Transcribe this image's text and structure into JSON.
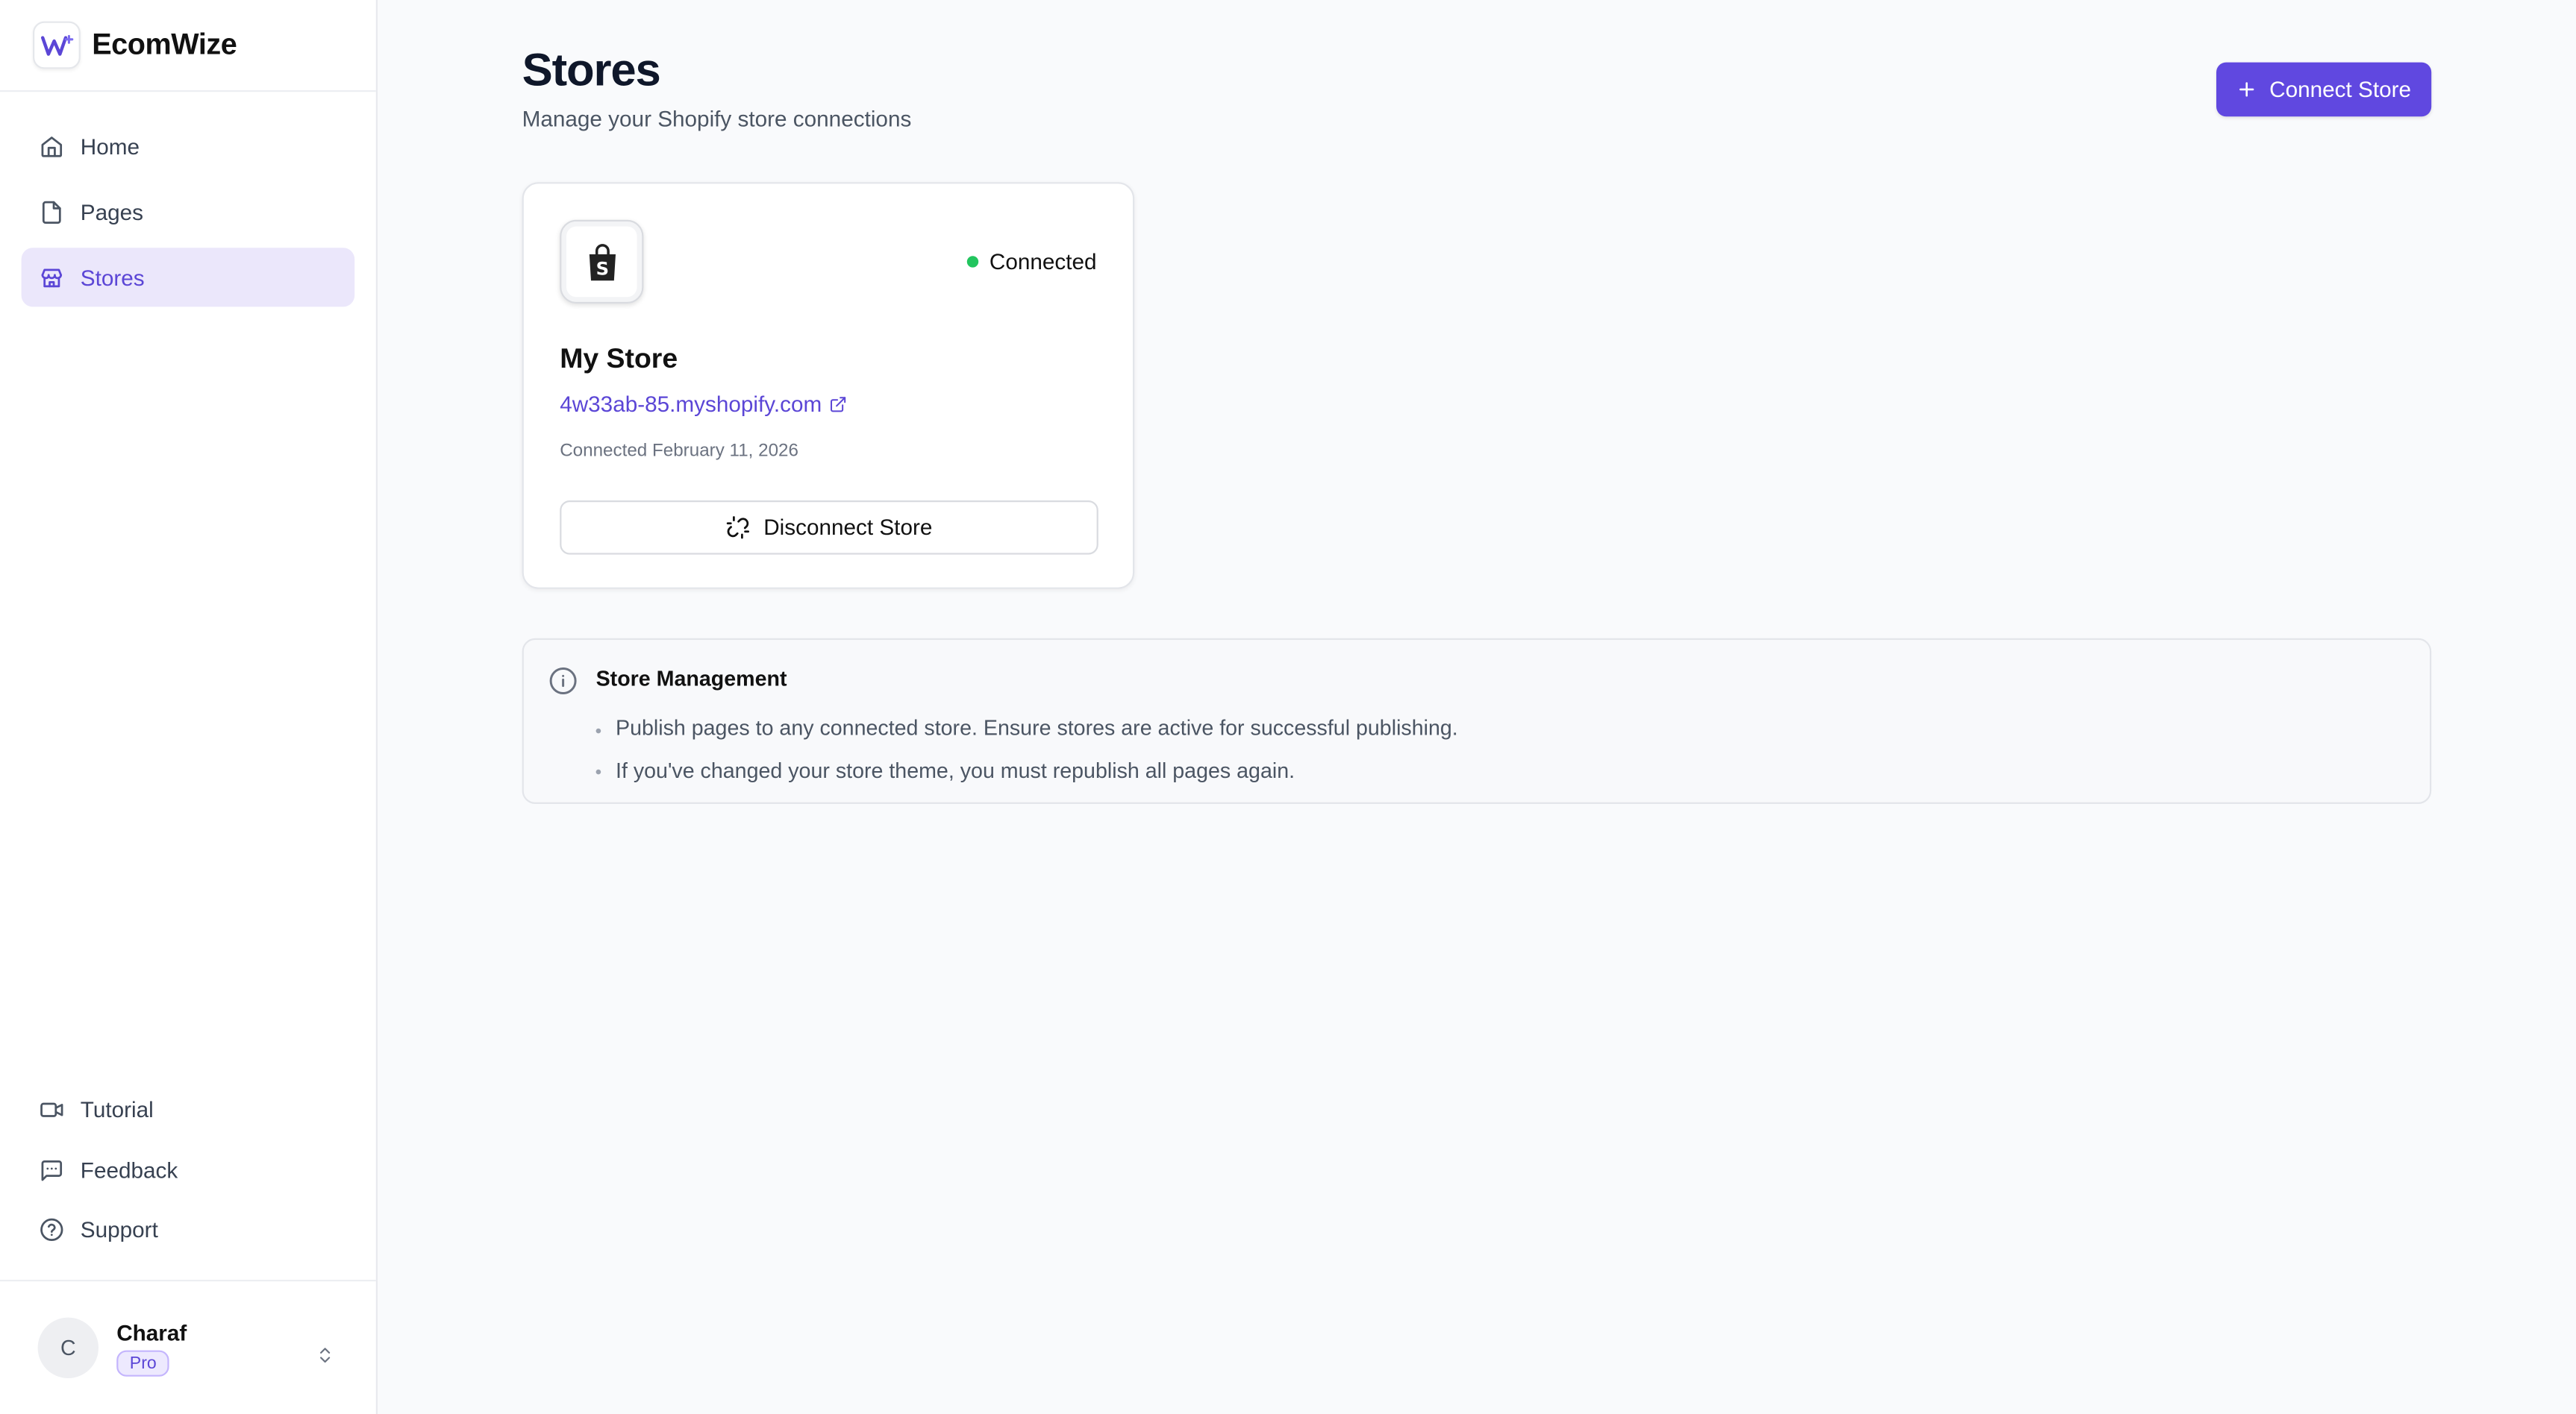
{
  "app": {
    "name": "EcomWize"
  },
  "sidebar": {
    "items": [
      {
        "label": "Home",
        "icon": "home-icon"
      },
      {
        "label": "Pages",
        "icon": "file-icon"
      },
      {
        "label": "Stores",
        "icon": "store-icon",
        "active": true
      }
    ],
    "bottom_items": [
      {
        "label": "Tutorial",
        "icon": "video-icon"
      },
      {
        "label": "Feedback",
        "icon": "message-square-icon"
      },
      {
        "label": "Support",
        "icon": "help-circle-icon"
      }
    ],
    "user": {
      "initial": "C",
      "name": "Charaf",
      "plan": "Pro"
    }
  },
  "header": {
    "title": "Stores",
    "subtitle": "Manage your Shopify store connections",
    "connect_label": "Connect Store"
  },
  "store": {
    "status": "Connected",
    "status_color": "#22c55e",
    "name": "My Store",
    "url": "4w33ab-85.myshopify.com",
    "connected_date": "Connected February 11, 2026",
    "disconnect_label": "Disconnect Store"
  },
  "info": {
    "title": "Store Management",
    "items": [
      "Publish pages to any connected store. Ensure stores are active for successful publishing.",
      "If you've changed your store theme, you must republish all pages again."
    ]
  },
  "colors": {
    "accent": "#6048e0",
    "active_bg": "#ebe7fb"
  }
}
